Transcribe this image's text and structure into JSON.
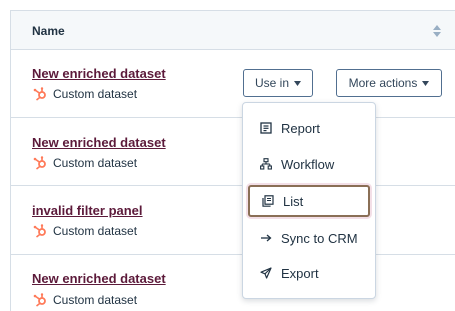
{
  "table": {
    "column_name": "Name"
  },
  "rows": [
    {
      "title": "New enriched dataset",
      "type": "Custom dataset"
    },
    {
      "title": "New enriched dataset",
      "type": "Custom dataset"
    },
    {
      "title": "invalid filter panel",
      "type": "Custom dataset"
    },
    {
      "title": "New enriched dataset",
      "type": "Custom dataset"
    }
  ],
  "actions": {
    "use_in_label": "Use in",
    "more_actions_label": "More actions"
  },
  "menu": {
    "items": [
      {
        "label": "Report",
        "icon": "report-icon"
      },
      {
        "label": "Workflow",
        "icon": "workflow-icon"
      },
      {
        "label": "List",
        "icon": "list-icon"
      },
      {
        "label": "Sync to CRM",
        "icon": "arrow-right-icon"
      },
      {
        "label": "Export",
        "icon": "export-icon"
      }
    ]
  },
  "colors": {
    "link": "#5c1a3a",
    "brand_orange": "#ff7a59",
    "focus_ring": "#8a6f56"
  }
}
